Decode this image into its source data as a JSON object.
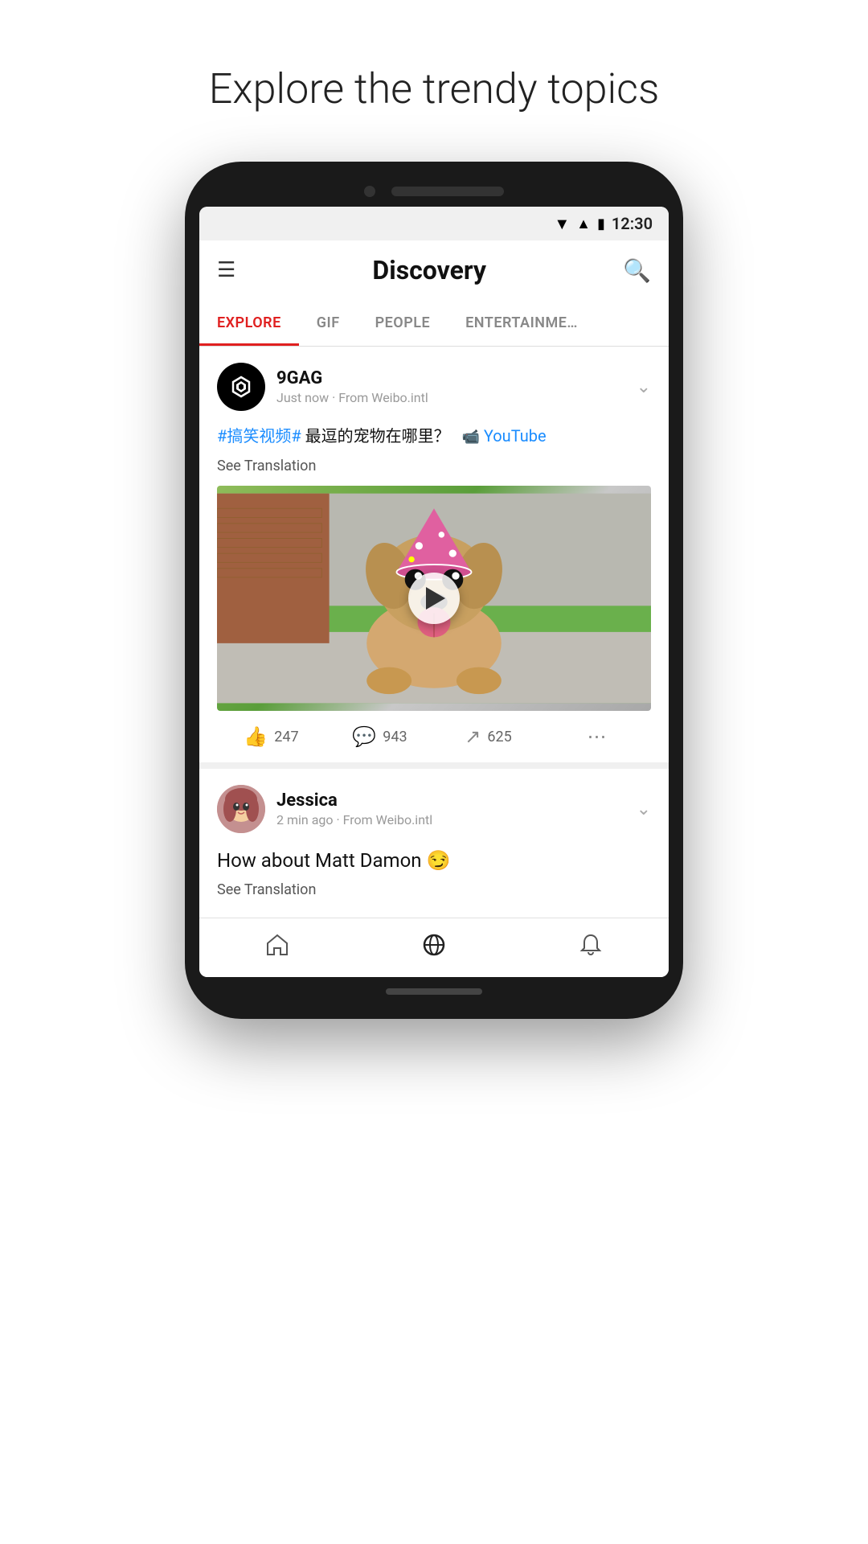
{
  "page": {
    "heading": "Explore the trendy topics"
  },
  "status_bar": {
    "time": "12:30"
  },
  "app_bar": {
    "title": "Discovery",
    "search_label": "search"
  },
  "tabs": [
    {
      "label": "EXPLORE",
      "active": true
    },
    {
      "label": "GIF",
      "active": false
    },
    {
      "label": "PEOPLE",
      "active": false
    },
    {
      "label": "ENTERTAINME…",
      "active": false
    }
  ],
  "posts": [
    {
      "username": "9GAG",
      "meta": "Just now · From Weibo.intl",
      "text_hashtag": "#搞笑视频#",
      "text_content": " 最逗的宠物在哪里？",
      "yt_label": "YouTube",
      "see_translation": "See Translation",
      "likes": "247",
      "comments": "943",
      "shares": "625"
    },
    {
      "username": "Jessica",
      "meta": "2 min ago · From Weibo.intl",
      "text": "How about Matt Damon 😏",
      "see_translation": "See Translation"
    }
  ],
  "bottom_nav": {
    "home_label": "home",
    "discover_label": "discover",
    "bell_label": "notifications"
  },
  "colors": {
    "accent_red": "#e02020",
    "hashtag_blue": "#1a8cff",
    "tab_active": "#e02020"
  }
}
